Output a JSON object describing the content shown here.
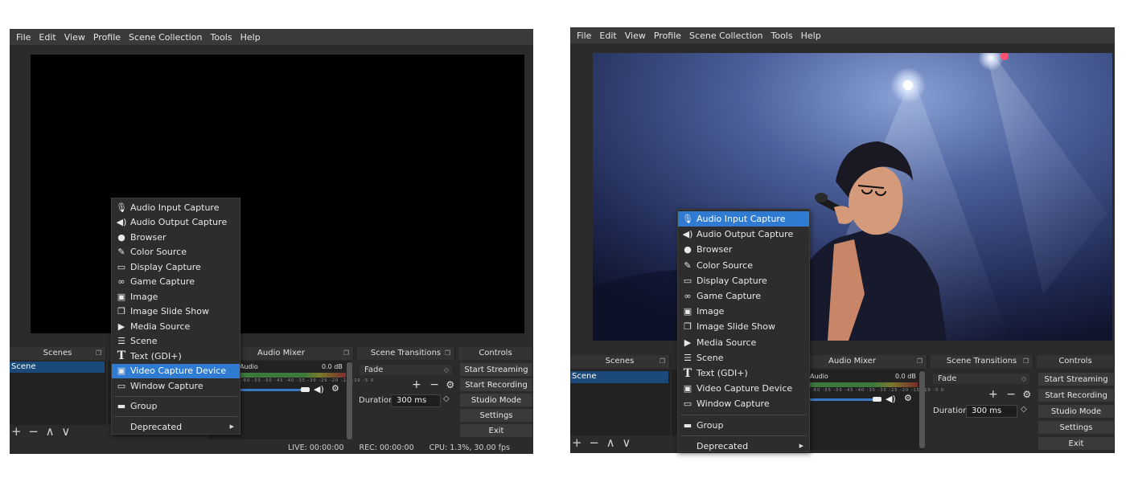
{
  "menu": [
    "File",
    "Edit",
    "View",
    "Profile",
    "Scene Collection",
    "Tools",
    "Help"
  ],
  "docks": {
    "scenes": "Scenes",
    "audio_mixer": "Audio Mixer",
    "scene_transitions": "Scene Transitions",
    "controls": "Controls"
  },
  "scene_list": [
    "Scene"
  ],
  "scene_buttons": "+ − ∧ ∨",
  "mixer": {
    "channel": "Audio",
    "level": "0.0 dB",
    "ticks": "-60 -55 -50 -45 -40 -35 -30 -25 -20 -15 -10 -5 0"
  },
  "transitions": {
    "selected": "Fade",
    "duration_label": "Duration",
    "duration_value": "300 ms"
  },
  "controls": [
    "Start Streaming",
    "Start Recording",
    "Studio Mode",
    "Settings",
    "Exit"
  ],
  "status": {
    "live": "LIVE: 00:00:00",
    "rec": "REC: 00:00:00",
    "cpu": "CPU: 1.3%, 30.00 fps"
  },
  "context_menu": {
    "items": [
      {
        "label": "Audio Input Capture",
        "icon": "microphone-icon"
      },
      {
        "label": "Audio Output Capture",
        "icon": "speaker-icon"
      },
      {
        "label": "Browser",
        "icon": "globe-icon"
      },
      {
        "label": "Color Source",
        "icon": "brush-icon"
      },
      {
        "label": "Display Capture",
        "icon": "monitor-icon"
      },
      {
        "label": "Game Capture",
        "icon": "gamepad-icon"
      },
      {
        "label": "Image",
        "icon": "image-icon"
      },
      {
        "label": "Image Slide Show",
        "icon": "slideshow-icon"
      },
      {
        "label": "Media Source",
        "icon": "play-icon"
      },
      {
        "label": "Scene",
        "icon": "list-icon"
      },
      {
        "label": "Text (GDI+)",
        "icon": "text-icon"
      },
      {
        "label": "Video Capture Device",
        "icon": "camera-icon"
      },
      {
        "label": "Window Capture",
        "icon": "window-icon"
      }
    ],
    "group": "Group",
    "deprecated": "Deprecated"
  },
  "left_highlight": "Video Capture Device",
  "right_highlight": "Audio Input Capture",
  "colors": {
    "highlight": "#2f7bd1",
    "selection": "#1b4a7a",
    "background": "#2b2b2b"
  }
}
